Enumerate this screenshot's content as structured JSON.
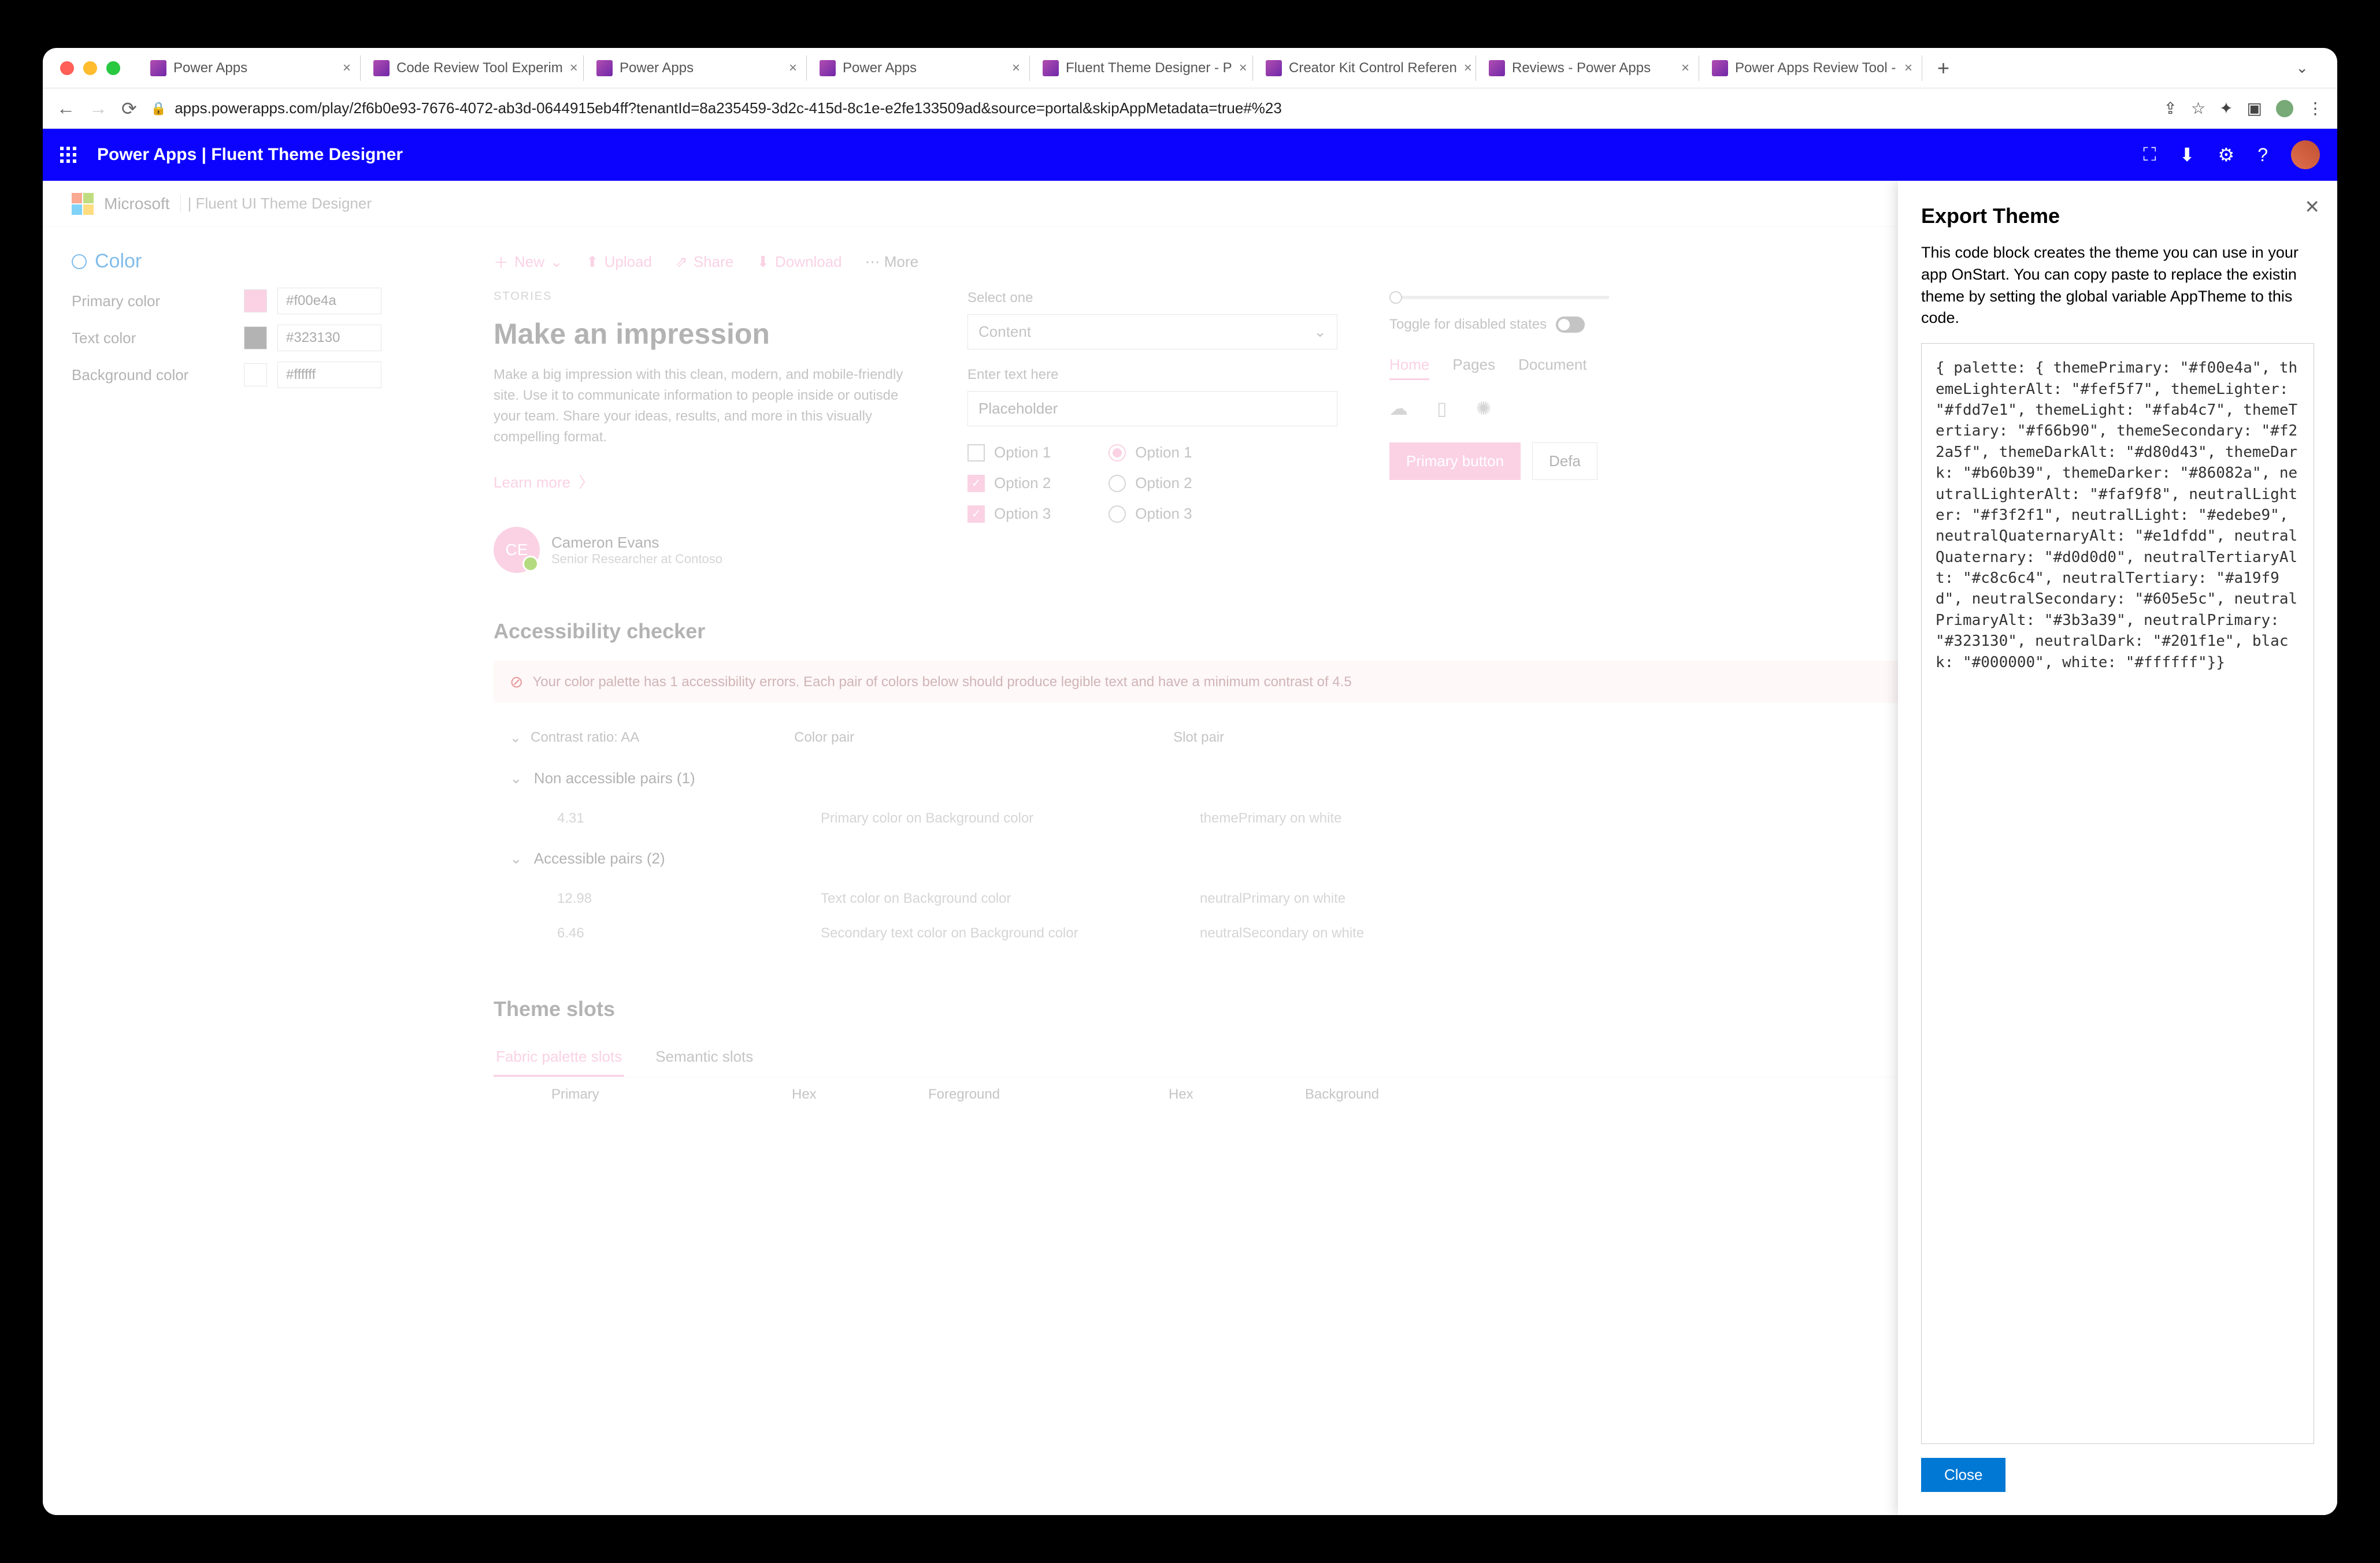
{
  "browser": {
    "tabs": [
      {
        "label": "Power Apps"
      },
      {
        "label": "Code Review Tool Experim"
      },
      {
        "label": "Power Apps"
      },
      {
        "label": "Power Apps"
      },
      {
        "label": "Fluent Theme Designer - P",
        "active": true
      },
      {
        "label": "Creator Kit Control Referen"
      },
      {
        "label": "Reviews - Power Apps"
      },
      {
        "label": "Power Apps Review Tool -"
      }
    ],
    "url": "apps.powerapps.com/play/2f6b0e93-7676-4072-ab3d-0644915eb4ff?tenantId=8a235459-3d2c-415d-8c1e-e2fe133509ad&source=portal&skipAppMetadata=true#%23"
  },
  "app_bar": {
    "title": "Power Apps  |  Fluent Theme Designer"
  },
  "designer_bar": {
    "brand": "Microsoft",
    "title": "| Fluent UI Theme Designer"
  },
  "sidebar": {
    "section": "Color",
    "rows": [
      {
        "label": "Primary color",
        "hex": "#f00e4a"
      },
      {
        "label": "Text color",
        "hex": "#323130"
      },
      {
        "label": "Background color",
        "hex": "#ffffff"
      }
    ]
  },
  "actions": {
    "new": "New",
    "upload": "Upload",
    "share": "Share",
    "download": "Download",
    "more": "More"
  },
  "hero": {
    "eyebrow": "STORIES",
    "title": "Make an impression",
    "body": "Make a big impression with this clean, modern, and mobile-friendly site. Use it to communicate information to people inside or outisde your team. Share your ideas, results, and more in this visually compelling format.",
    "learn": "Learn more",
    "persona": {
      "initials": "CE",
      "name": "Cameron Evans",
      "role": "Senior Researcher at Contoso"
    }
  },
  "form": {
    "select_label": "Select one",
    "select_value": "Content",
    "text_label": "Enter text here",
    "text_placeholder": "Placeholder",
    "checks": [
      "Option 1",
      "Option 2",
      "Option 3"
    ],
    "radios": [
      "Option 1",
      "Option 2",
      "Option 3"
    ]
  },
  "right": {
    "toggle_label": "Toggle for disabled states",
    "tabs": [
      "Home",
      "Pages",
      "Document"
    ],
    "buttons": {
      "primary": "Primary button",
      "default": "Defa"
    }
  },
  "accessibility": {
    "title": "Accessibility checker",
    "error": "Your color palette has 1 accessibility errors. Each pair of colors below should produce legible text and have a minimum contrast of 4.5",
    "headers": {
      "c1": "Contrast ratio: AA",
      "c2": "Color pair",
      "c3": "Slot pair"
    },
    "sections": [
      {
        "title": "Non accessible pairs (1)",
        "rows": [
          {
            "ratio": "4.31",
            "pair": "Primary color on Background color",
            "slot": "themePrimary on white"
          }
        ]
      },
      {
        "title": "Accessible pairs (2)",
        "rows": [
          {
            "ratio": "12.98",
            "pair": "Text color on Background color",
            "slot": "neutralPrimary on white"
          },
          {
            "ratio": "6.46",
            "pair": "Secondary text color on Background color",
            "slot": "neutralSecondary on white"
          }
        ]
      }
    ]
  },
  "theme_slots": {
    "title": "Theme slots",
    "tabs": [
      "Fabric palette slots",
      "Semantic slots"
    ],
    "headers": [
      "Primary",
      "Hex",
      "Foreground",
      "Hex",
      "Background"
    ]
  },
  "panel": {
    "title": "Export Theme",
    "desc": "This code block creates the theme you can use in your app OnStart. You can copy paste to replace the existin theme by setting the global variable AppTheme to this code.",
    "code": "{ palette: { themePrimary: \"#f00e4a\", themeLighterAlt: \"#fef5f7\", themeLighter: \"#fdd7e1\", themeLight: \"#fab4c7\", themeTertiary: \"#f66b90\", themeSecondary: \"#f22a5f\", themeDarkAlt: \"#d80d43\", themeDark: \"#b60b39\", themeDarker: \"#86082a\", neutralLighterAlt: \"#faf9f8\", neutralLighter: \"#f3f2f1\", neutralLight: \"#edebe9\", neutralQuaternaryAlt: \"#e1dfdd\", neutralQuaternary: \"#d0d0d0\", neutralTertiaryAlt: \"#c8c6c4\", neutralTertiary: \"#a19f9d\", neutralSecondary: \"#605e5c\", neutralPrimaryAlt: \"#3b3a39\", neutralPrimary: \"#323130\", neutralDark: \"#201f1e\", black: \"#000000\", white: \"#ffffff\"}}",
    "close": "Close"
  }
}
